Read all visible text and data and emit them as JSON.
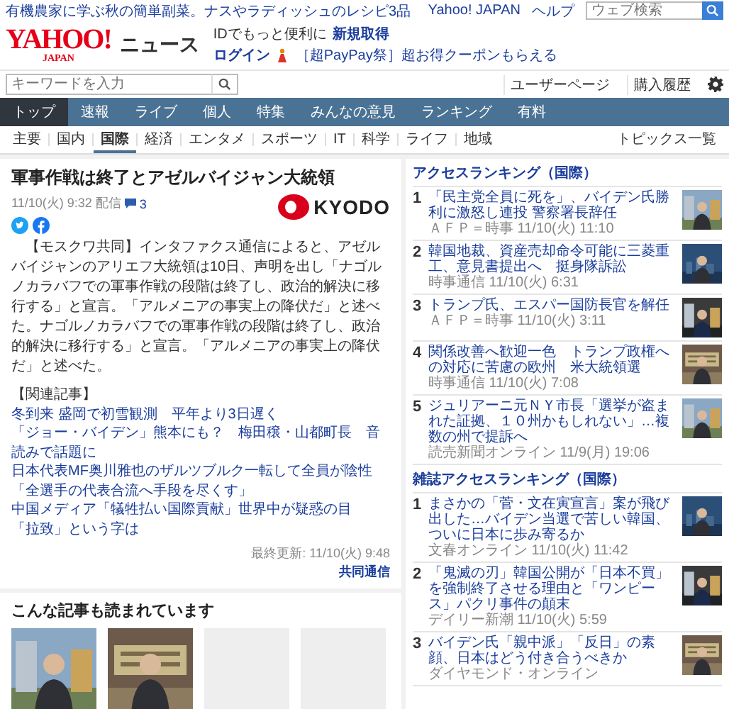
{
  "promo_bar": {
    "headline": "有機農家に学ぶ秋の簡単副菜。ナスやラディッシュのレシピ3品",
    "links": [
      "Yahoo! JAPAN",
      "ヘルプ"
    ],
    "search": {
      "placeholder": "ウェブ検索"
    }
  },
  "header": {
    "logo": {
      "name": "YAHOO!",
      "sub": "JAPAN"
    },
    "service": "ニュース",
    "id_text": "IDでもっと便利に",
    "signup": "新規取得",
    "login": "ログイン",
    "campaign": "［超PayPay祭］超お得クーポンもらえる"
  },
  "search_row": {
    "placeholder": "キーワードを入力",
    "links": [
      "ユーザーページ",
      "購入履歴"
    ]
  },
  "tabs": [
    {
      "label": "トップ",
      "selected": true
    },
    {
      "label": "速報",
      "selected": false
    },
    {
      "label": "ライブ",
      "selected": false
    },
    {
      "label": "個人",
      "selected": false
    },
    {
      "label": "特集",
      "selected": false
    },
    {
      "label": "みんなの意見",
      "selected": false
    },
    {
      "label": "ランキング",
      "selected": false
    },
    {
      "label": "有料",
      "selected": false
    }
  ],
  "categories": [
    {
      "label": "主要",
      "selected": false
    },
    {
      "label": "国内",
      "selected": false
    },
    {
      "label": "国際",
      "selected": true
    },
    {
      "label": "経済",
      "selected": false
    },
    {
      "label": "エンタメ",
      "selected": false
    },
    {
      "label": "スポーツ",
      "selected": false
    },
    {
      "label": "IT",
      "selected": false
    },
    {
      "label": "科学",
      "selected": false
    },
    {
      "label": "ライフ",
      "selected": false
    },
    {
      "label": "地域",
      "selected": false
    }
  ],
  "topics_link": "トピックス一覧",
  "article": {
    "title": "軍事作戦は終了とアゼルバイジャン大統領",
    "published": "11/10(火) 9:32 配信",
    "comments": "3",
    "source_logo": "KYODO",
    "body": "【モスクワ共同】インタファクス通信によると、アゼルバイジャンのアリエフ大統領は10日、声明を出し「ナゴルノカラバフでの軍事作戦の段階は終了し、政治的解決に移行する」と宣言。「アルメニアの事実上の降伏だ」と述べた。ナゴルノカラバフでの軍事作戦の段階は終了し、政治的解決に移行する」と宣言。「アルメニアの事実上の降伏だ」と述べた。",
    "related_heading": "【関連記事】",
    "related": [
      "冬到来 盛岡で初雪観測　平年より3日遅く",
      "「ジョー・バイデン」熊本にも？　梅田穣・山都町長　音読みで話題に",
      "日本代表MF奥川雅也のザルツブルク一転して全員が陰性「全選手の代表合流へ手段を尽くす」",
      "中国メディア「犠牲払い国際貢献」世界中が疑惑の目",
      "「拉致」という字は"
    ],
    "updated": "最終更新: 11/10(火) 9:48",
    "provider": "共同通信"
  },
  "also_read": {
    "heading": "こんな記事も読まれています",
    "cards": [
      {
        "kind": "picture"
      },
      {
        "kind": "picture"
      },
      {
        "kind": "placeholder"
      },
      {
        "kind": "placeholder"
      }
    ]
  },
  "rankings": [
    {
      "heading": "アクセスランキング（国際）",
      "items": [
        {
          "rank": "1",
          "title": "「民主党全員に死を」、バイデン氏勝利に激怒し連投 警察署長辞任",
          "source": "ＡＦＰ＝時事 11/10(火) 11:10"
        },
        {
          "rank": "2",
          "title": "韓国地裁、資産売却命令可能に三菱重工、意見書提出へ　挺身隊訴訟",
          "source": "時事通信 11/10(火) 6:31"
        },
        {
          "rank": "3",
          "title": "トランプ氏、エスパー国防長官を解任",
          "source": "ＡＦＰ＝時事 11/10(火) 3:11"
        },
        {
          "rank": "4",
          "title": "関係改善へ歓迎一色　トランプ政権への対応に苦慮の欧州　米大統領選",
          "source": "時事通信 11/10(火) 7:08"
        },
        {
          "rank": "5",
          "title": "ジュリアーニ元ＮＹ市長「選挙が盗まれた証拠、１０州かもしれない」…複数の州で提訴へ",
          "source": "読売新聞オンライン 11/9(月) 19:06"
        }
      ]
    },
    {
      "heading": "雑誌アクセスランキング（国際）",
      "items": [
        {
          "rank": "1",
          "title": "まさかの「菅・文在寅宣言」案が飛び出した…バイデン当選で苦しい韓国、ついに日本に歩み寄るか",
          "source": "文春オンライン 11/10(火) 11:42"
        },
        {
          "rank": "2",
          "title": "「鬼滅の刃」韓国公開が「日本不買」を強制終了させる理由と「ワンピース」パクリ事件の顛末",
          "source": "デイリー新潮 11/10(火) 5:59"
        },
        {
          "rank": "3",
          "title": "バイデン氏「親中派」「反日」の素顔、日本はどう付き合うべきか",
          "source": "ダイヤモンド・オンライン"
        }
      ]
    }
  ]
}
